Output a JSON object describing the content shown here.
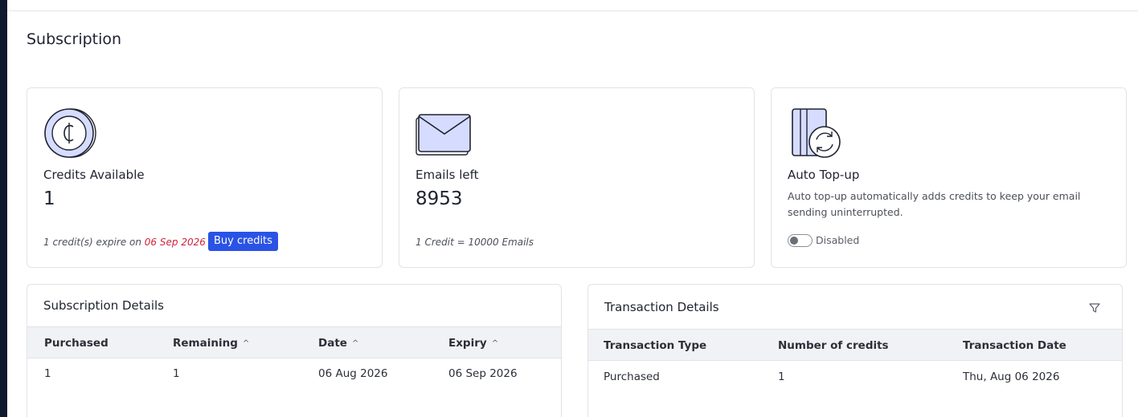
{
  "page": {
    "title": "Subscription"
  },
  "cards": {
    "credits": {
      "icon": "coin-icon",
      "label": "Credits Available",
      "value": "1",
      "expire_prefix": "1 credit(s) expire on",
      "expire_date": "06 Sep 2026",
      "buy_label": "Buy credits"
    },
    "emails": {
      "icon": "envelope-icon",
      "label": "Emails left",
      "value": "8953",
      "note": "1 Credit = 10000 Emails"
    },
    "topup": {
      "icon": "card-refresh-icon",
      "label": "Auto Top-up",
      "description": "Auto top-up automatically adds credits to keep your email sending uninterrupted.",
      "toggle_state": "Disabled",
      "enabled": false
    }
  },
  "subscription_details": {
    "title": "Subscription Details",
    "columns": [
      "Purchased",
      "Remaining",
      "Date",
      "Expiry"
    ],
    "sortable": [
      false,
      true,
      true,
      true
    ],
    "rows": [
      [
        "1",
        "1",
        "06 Aug 2026",
        "06 Sep 2026"
      ]
    ]
  },
  "transaction_details": {
    "title": "Transaction Details",
    "filter_icon": "filter-icon",
    "columns": [
      "Transaction Type",
      "Number of credits",
      "Transaction Date"
    ],
    "rows": [
      [
        "Purchased",
        "1",
        "Thu, Aug 06 2026"
      ]
    ]
  },
  "colors": {
    "accent": "#2a53e6",
    "expire": "#d0223a",
    "icon_fill": "#d6dcff",
    "rail": "#0f1a2e"
  }
}
